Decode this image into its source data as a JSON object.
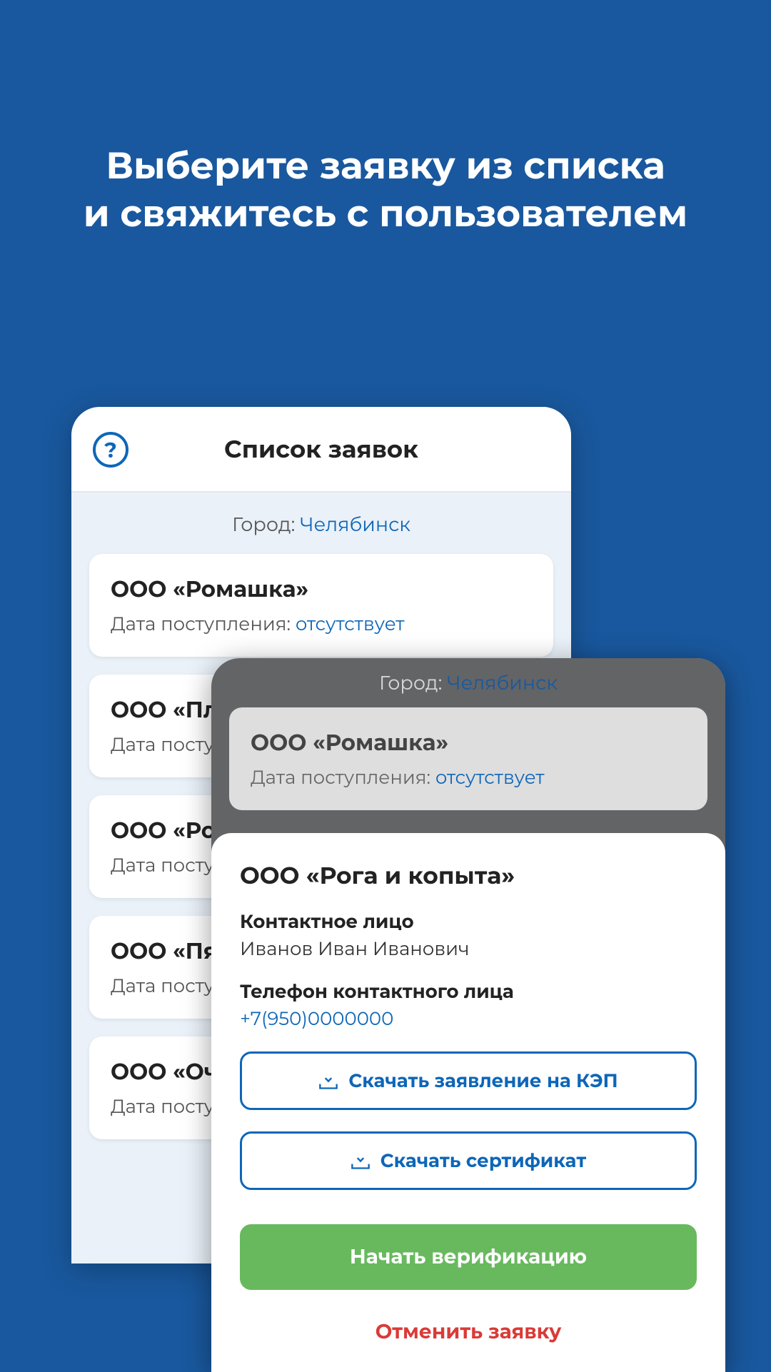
{
  "headline_l1": "Выберите заявку из списка",
  "headline_l2": "и свяжитесь с пользователем",
  "back": {
    "title": "Список заявок",
    "city_label": "Город: ",
    "city_value": "Челябинск",
    "date_label": "Дата поступления: ",
    "items": [
      {
        "org": "ООО «Ромашка»",
        "date_value": "отсутствует"
      },
      {
        "org": "ООО «Пл",
        "date_value": ""
      },
      {
        "org": "ООО «Ро",
        "date_value": ""
      },
      {
        "org": "ООО «Пя",
        "date_value": ""
      },
      {
        "org": "ООО «Оч",
        "date_value": ""
      }
    ],
    "date_label_cut": "Дата посту"
  },
  "front": {
    "city_label": "Город: ",
    "city_value": "Челябинск",
    "bg_item": {
      "org": "ООО «Ромашка»",
      "date_label": "Дата поступления: ",
      "date_value": "отсутствует"
    },
    "sheet": {
      "org": "ООО «Рога и копыта»",
      "contact_label": "Контактное лицо",
      "contact_value": "Иванов Иван Иванович",
      "phone_label": "Телефон контактного лица",
      "phone_value": "+7(950)0000000",
      "btn_download_app": "Скачать заявление на КЭП",
      "btn_download_cert": "Скачать сертификат",
      "btn_start": "Начать верификацию",
      "btn_cancel": "Отменить заявку"
    }
  }
}
